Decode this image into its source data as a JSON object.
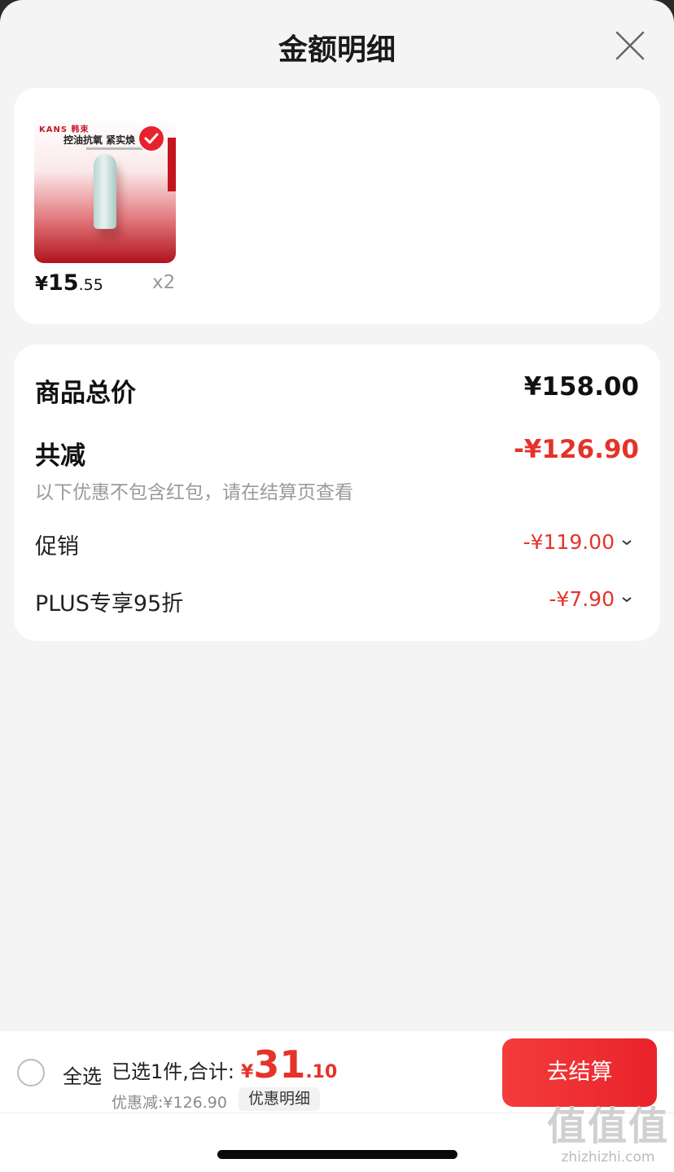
{
  "header": {
    "title": "金额明细"
  },
  "product": {
    "image_brand": "KANS 韩束",
    "image_slogan": "控油抗氧 紧实焕",
    "price_yen": "¥",
    "price_int": "15",
    "price_dec": ".55",
    "quantity": "x2"
  },
  "summary": {
    "total_label": "商品总价",
    "total_value": "¥158.00",
    "reduce_label": "共减",
    "reduce_value": "-¥126.90",
    "reduce_note": "以下优惠不包含红包，请在结算页查看",
    "promo_label": "促销",
    "promo_value": "-¥119.00",
    "plus_label": "PLUS专享95折",
    "plus_value": "-¥7.90"
  },
  "footer": {
    "select_all": "全选",
    "selected_info": "已选1件,合计:",
    "total_yen": "¥",
    "total_int": "31",
    "total_dec": ".10",
    "discount_text": "优惠减:¥126.90",
    "detail_label": "优惠明细",
    "checkout_label": "去结算"
  },
  "watermark": {
    "logo": "值值值",
    "url": "zhizhizhi.com"
  },
  "colors": {
    "accent_red": "#e4332a",
    "checkout_red": "#f43c3c"
  }
}
